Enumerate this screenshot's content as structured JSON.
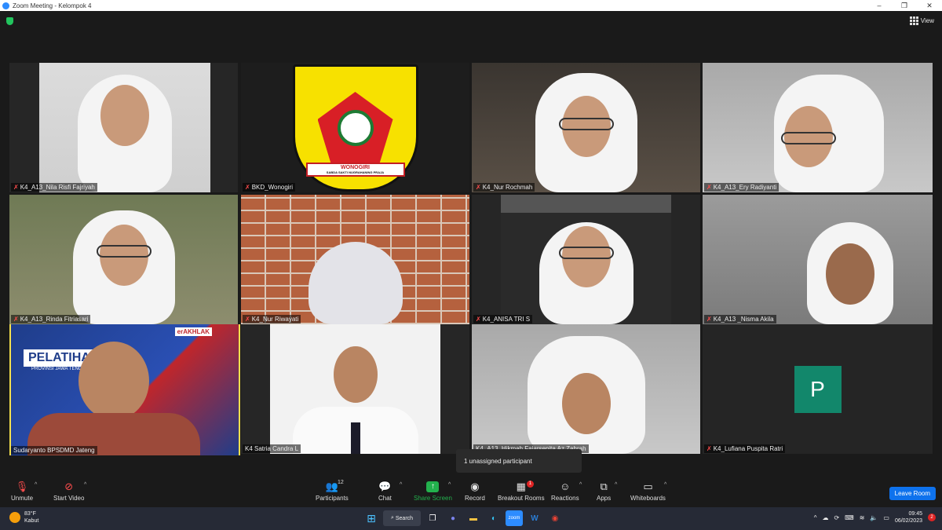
{
  "window": {
    "title": "Zoom Meeting - Kelompok 4",
    "min": "–",
    "max": "❐",
    "close": "✕"
  },
  "view": {
    "label": "View"
  },
  "participants": [
    {
      "name": "K4_A13_Nila Risfi Fajriyah",
      "muted": true
    },
    {
      "name": "BKD_Wonogiri",
      "muted": true
    },
    {
      "name": "K4_Nur Rochmah",
      "muted": true
    },
    {
      "name": "K4_A13_Ery Radiyanti",
      "muted": true
    },
    {
      "name": "K4_A13_Rinda Fitriasari",
      "muted": true
    },
    {
      "name": "K4_Nur Riwayati",
      "muted": true
    },
    {
      "name": "K4_ANISA TRI S",
      "muted": true
    },
    {
      "name": "K4_A13 _Nisma Akila",
      "muted": true
    },
    {
      "name": "Sudaryanto BPSDMD Jateng",
      "muted": false
    },
    {
      "name": "K4 Satria Candra L",
      "muted": false
    },
    {
      "name": "K4_A13_Hikmah Fajarsenita Az Zahrah",
      "muted": false
    },
    {
      "name": "K4_Lufiana Puspita Ratri",
      "muted": true
    }
  ],
  "logo": {
    "ribbon": "WONOGIRI",
    "motto": "SABDA SAKTI NUGRAHANING PRAJA"
  },
  "banner": {
    "title": "PELATIHAN L",
    "subtitle": "PROVINSI JAWA TENGAH",
    "akhlak": "erAKHLAK"
  },
  "avatar_letter": "P",
  "tooltip": "1 unassigned participant",
  "toolbar": {
    "unmute": "Unmute",
    "start_video": "Start Video",
    "participants": "Participants",
    "participants_count": "12",
    "chat": "Chat",
    "share_screen": "Share Screen",
    "record": "Record",
    "breakout_rooms": "Breakout Rooms",
    "breakout_badge": "1",
    "reactions": "Reactions",
    "apps": "Apps",
    "whiteboards": "Whiteboards",
    "leave": "Leave Room"
  },
  "taskbar": {
    "temperature": "83°F",
    "weather": "Kabut",
    "search": "Search",
    "time": "09:45",
    "date": "06/02/2023",
    "notifications": "2"
  }
}
